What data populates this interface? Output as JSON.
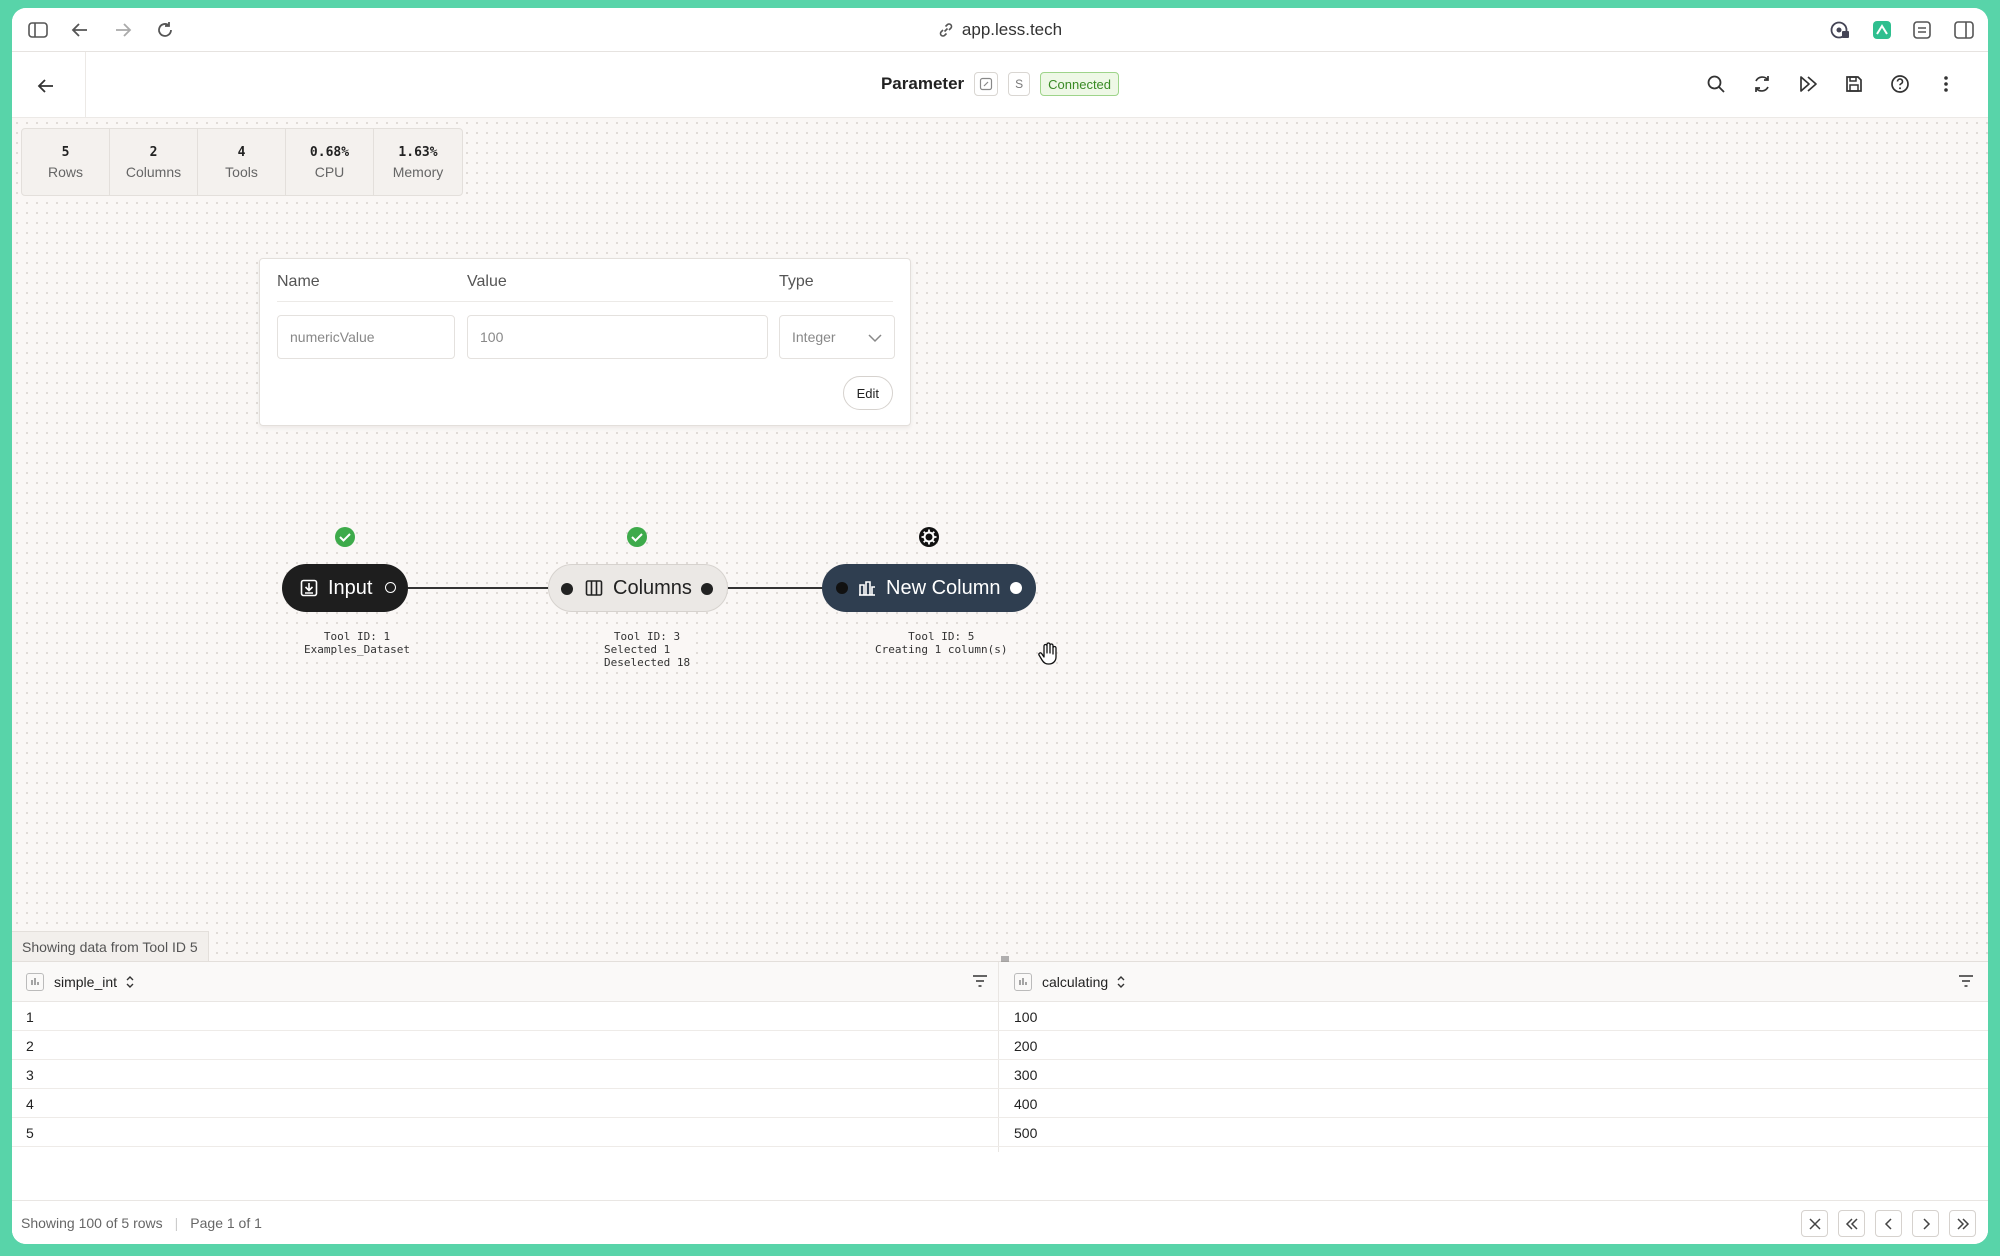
{
  "browser": {
    "url": "app.less.tech"
  },
  "header": {
    "title": "Parameter",
    "chip_s": "S",
    "status": "Connected"
  },
  "stats": [
    {
      "value": "5",
      "label": "Rows"
    },
    {
      "value": "2",
      "label": "Columns"
    },
    {
      "value": "4",
      "label": "Tools"
    },
    {
      "value": "0.68%",
      "label": "CPU"
    },
    {
      "value": "1.63%",
      "label": "Memory"
    }
  ],
  "param_panel": {
    "headers": {
      "name": "Name",
      "value": "Value",
      "type": "Type"
    },
    "name_value": "numericValue",
    "value_value": "100",
    "type_value": "Integer",
    "edit_label": "Edit"
  },
  "nodes": [
    {
      "label": "Input",
      "meta": [
        "Tool ID: 1",
        "Examples_Dataset"
      ],
      "status": "success"
    },
    {
      "label": "Columns",
      "meta": [
        "Tool ID: 3",
        "Selected 1",
        "Deselected 18"
      ],
      "status": "success"
    },
    {
      "label": "New Column",
      "meta": [
        "Tool ID: 5",
        "Creating 1 column(s)"
      ],
      "status": "configure"
    }
  ],
  "canvas": {
    "showing_from": "Showing data from Tool ID 5"
  },
  "table": {
    "columns": [
      "simple_int",
      "calculating"
    ],
    "rows": [
      [
        "1",
        "100"
      ],
      [
        "2",
        "200"
      ],
      [
        "3",
        "300"
      ],
      [
        "4",
        "400"
      ],
      [
        "5",
        "500"
      ]
    ]
  },
  "footer": {
    "showing": "Showing 100 of 5 rows",
    "page": "Page 1 of 1"
  },
  "colors": {
    "background": "#58d4a9",
    "connected": "#3a8a25",
    "success": "#3daa4a",
    "node_dark": "#1e1e1e",
    "node_selected": "#2f3e50"
  }
}
